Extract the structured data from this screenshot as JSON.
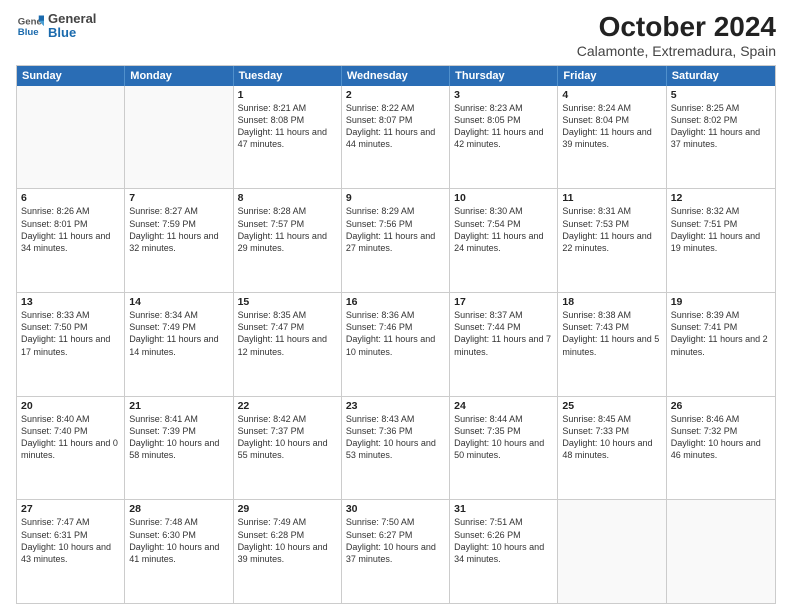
{
  "logo": {
    "general": "General",
    "blue": "Blue"
  },
  "title": "October 2024",
  "subtitle": "Calamonte, Extremadura, Spain",
  "days": [
    "Sunday",
    "Monday",
    "Tuesday",
    "Wednesday",
    "Thursday",
    "Friday",
    "Saturday"
  ],
  "weeks": [
    [
      {
        "day": "",
        "info": ""
      },
      {
        "day": "",
        "info": ""
      },
      {
        "day": "1",
        "info": "Sunrise: 8:21 AM\nSunset: 8:08 PM\nDaylight: 11 hours and 47 minutes."
      },
      {
        "day": "2",
        "info": "Sunrise: 8:22 AM\nSunset: 8:07 PM\nDaylight: 11 hours and 44 minutes."
      },
      {
        "day": "3",
        "info": "Sunrise: 8:23 AM\nSunset: 8:05 PM\nDaylight: 11 hours and 42 minutes."
      },
      {
        "day": "4",
        "info": "Sunrise: 8:24 AM\nSunset: 8:04 PM\nDaylight: 11 hours and 39 minutes."
      },
      {
        "day": "5",
        "info": "Sunrise: 8:25 AM\nSunset: 8:02 PM\nDaylight: 11 hours and 37 minutes."
      }
    ],
    [
      {
        "day": "6",
        "info": "Sunrise: 8:26 AM\nSunset: 8:01 PM\nDaylight: 11 hours and 34 minutes."
      },
      {
        "day": "7",
        "info": "Sunrise: 8:27 AM\nSunset: 7:59 PM\nDaylight: 11 hours and 32 minutes."
      },
      {
        "day": "8",
        "info": "Sunrise: 8:28 AM\nSunset: 7:57 PM\nDaylight: 11 hours and 29 minutes."
      },
      {
        "day": "9",
        "info": "Sunrise: 8:29 AM\nSunset: 7:56 PM\nDaylight: 11 hours and 27 minutes."
      },
      {
        "day": "10",
        "info": "Sunrise: 8:30 AM\nSunset: 7:54 PM\nDaylight: 11 hours and 24 minutes."
      },
      {
        "day": "11",
        "info": "Sunrise: 8:31 AM\nSunset: 7:53 PM\nDaylight: 11 hours and 22 minutes."
      },
      {
        "day": "12",
        "info": "Sunrise: 8:32 AM\nSunset: 7:51 PM\nDaylight: 11 hours and 19 minutes."
      }
    ],
    [
      {
        "day": "13",
        "info": "Sunrise: 8:33 AM\nSunset: 7:50 PM\nDaylight: 11 hours and 17 minutes."
      },
      {
        "day": "14",
        "info": "Sunrise: 8:34 AM\nSunset: 7:49 PM\nDaylight: 11 hours and 14 minutes."
      },
      {
        "day": "15",
        "info": "Sunrise: 8:35 AM\nSunset: 7:47 PM\nDaylight: 11 hours and 12 minutes."
      },
      {
        "day": "16",
        "info": "Sunrise: 8:36 AM\nSunset: 7:46 PM\nDaylight: 11 hours and 10 minutes."
      },
      {
        "day": "17",
        "info": "Sunrise: 8:37 AM\nSunset: 7:44 PM\nDaylight: 11 hours and 7 minutes."
      },
      {
        "day": "18",
        "info": "Sunrise: 8:38 AM\nSunset: 7:43 PM\nDaylight: 11 hours and 5 minutes."
      },
      {
        "day": "19",
        "info": "Sunrise: 8:39 AM\nSunset: 7:41 PM\nDaylight: 11 hours and 2 minutes."
      }
    ],
    [
      {
        "day": "20",
        "info": "Sunrise: 8:40 AM\nSunset: 7:40 PM\nDaylight: 11 hours and 0 minutes."
      },
      {
        "day": "21",
        "info": "Sunrise: 8:41 AM\nSunset: 7:39 PM\nDaylight: 10 hours and 58 minutes."
      },
      {
        "day": "22",
        "info": "Sunrise: 8:42 AM\nSunset: 7:37 PM\nDaylight: 10 hours and 55 minutes."
      },
      {
        "day": "23",
        "info": "Sunrise: 8:43 AM\nSunset: 7:36 PM\nDaylight: 10 hours and 53 minutes."
      },
      {
        "day": "24",
        "info": "Sunrise: 8:44 AM\nSunset: 7:35 PM\nDaylight: 10 hours and 50 minutes."
      },
      {
        "day": "25",
        "info": "Sunrise: 8:45 AM\nSunset: 7:33 PM\nDaylight: 10 hours and 48 minutes."
      },
      {
        "day": "26",
        "info": "Sunrise: 8:46 AM\nSunset: 7:32 PM\nDaylight: 10 hours and 46 minutes."
      }
    ],
    [
      {
        "day": "27",
        "info": "Sunrise: 7:47 AM\nSunset: 6:31 PM\nDaylight: 10 hours and 43 minutes."
      },
      {
        "day": "28",
        "info": "Sunrise: 7:48 AM\nSunset: 6:30 PM\nDaylight: 10 hours and 41 minutes."
      },
      {
        "day": "29",
        "info": "Sunrise: 7:49 AM\nSunset: 6:28 PM\nDaylight: 10 hours and 39 minutes."
      },
      {
        "day": "30",
        "info": "Sunrise: 7:50 AM\nSunset: 6:27 PM\nDaylight: 10 hours and 37 minutes."
      },
      {
        "day": "31",
        "info": "Sunrise: 7:51 AM\nSunset: 6:26 PM\nDaylight: 10 hours and 34 minutes."
      },
      {
        "day": "",
        "info": ""
      },
      {
        "day": "",
        "info": ""
      }
    ]
  ]
}
